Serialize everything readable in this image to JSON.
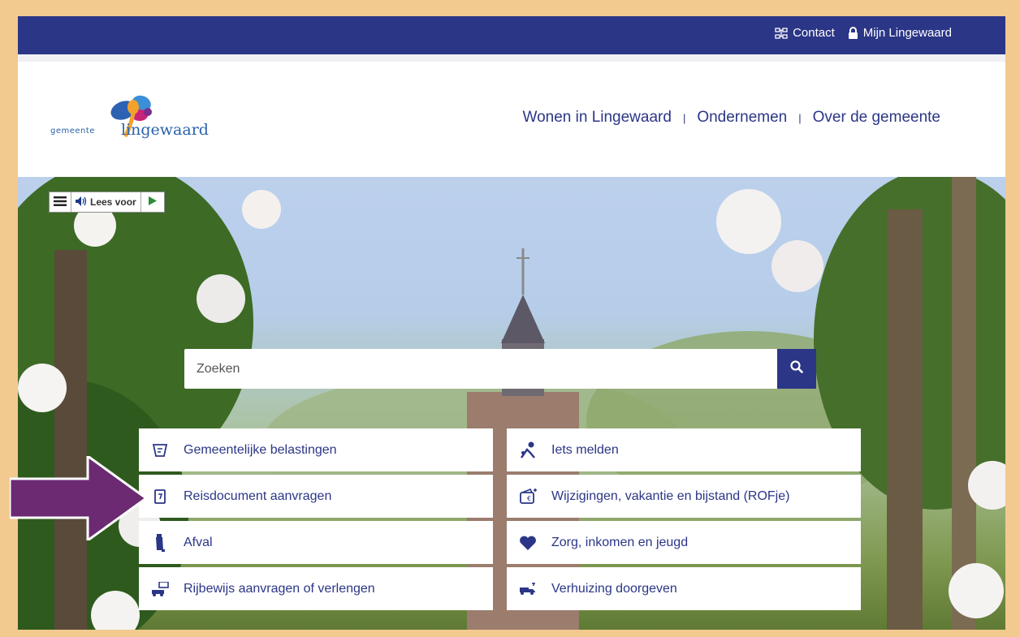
{
  "topbar": {
    "contact_label": "Contact",
    "account_label": "Mijn Lingewaard",
    "contact_icon": "sitemap-icon",
    "account_icon": "lock-icon",
    "color": "#2b3687"
  },
  "header": {
    "logo_small": "gemeente",
    "logo_big": "lingewaard",
    "nav": [
      "Wonen in Lingewaard",
      "Ondernemen",
      "Over de gemeente"
    ],
    "separator": "|"
  },
  "readspeaker": {
    "label": "Lees voor",
    "menu_icon": "hamburger-menu-icon",
    "speaker_icon": "speaker-icon",
    "play_icon": "play-icon"
  },
  "search": {
    "placeholder": "Zoeken",
    "value": "",
    "button_icon": "search-icon"
  },
  "tiles": [
    {
      "label": "Gemeentelijke belastingen",
      "icon": "tax-form-icon"
    },
    {
      "label": "Iets melden",
      "icon": "report-issue-icon"
    },
    {
      "label": "Reisdocument aanvragen",
      "icon": "passport-icon"
    },
    {
      "label": "Wijzigingen, vakantie en bijstand (ROFje)",
      "icon": "wallet-euro-icon"
    },
    {
      "label": "Afval",
      "icon": "waste-bin-icon"
    },
    {
      "label": "Zorg, inkomen en jeugd",
      "icon": "heart-icon"
    },
    {
      "label": "Rijbewijs aanvragen of verlengen",
      "icon": "car-license-icon"
    },
    {
      "label": "Verhuizing doorgeven",
      "icon": "moving-truck-icon"
    }
  ],
  "annotation": {
    "arrow_color": "#6b2a72",
    "arrow_icon": "arrow-right-icon"
  },
  "colors": {
    "accent": "#2b3687",
    "frame": "#f2c98f"
  }
}
